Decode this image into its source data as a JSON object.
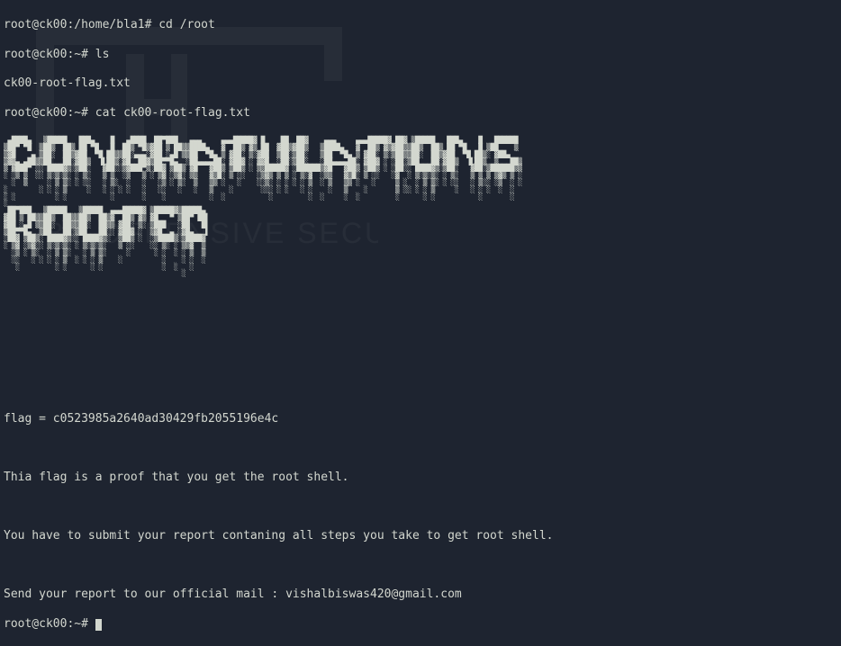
{
  "prompts": {
    "p0_userhost": "root@ck00",
    "p0_path": "/home/bla1",
    "p0_cmd": "cd /root",
    "p1_userhost": "root@ck00",
    "p1_path": "~",
    "p1_cmd": "ls",
    "ls_out": "ck00-root-flag.txt",
    "p2_userhost": "root@ck00",
    "p2_path": "~",
    "p2_cmd": "cat ck00-root-flag.txt",
    "p3_userhost": "root@ck00",
    "p3_path": "~",
    "p3_cmd": ""
  },
  "ascii_art": " ▄████▄   ▒█████   ███▄    █   ▄████  ██▀███   ▄▄▄     ▄▄▄█████▓ █    ██  ██▓    ▄▄▄     ▄▄▄█████▓ ██▓ ▒█████   ███▄    █   ██████ \n▒██▀ ▀█  ▒██▒  ██▒ ██ ▀█   █  ██▒ ▀█▒▓██ ▒ ██▒▒████▄   ▓  ██▒ ▓▒ ██  ▓██▒▓██▒   ▒████▄   ▓  ██▒ ▓▒▓██▒▒██▒  ██▒ ██ ▀█   █ ▒██    ▒ \n▒▓█    ▄ ▒██░  ██▒▓██  ▀█ ██▒▒██░▄▄▄░▓██ ░▄█ ▒▒██  ▀█▄ ▒ ▓██░ ▒░▓██  ▒██░▒██░   ▒██  ▀█▄ ▒ ▓██░ ▒░▒██▒▒██░  ██▒▓██  ▀█ ██▒░ ▓██▄   \n▒▓▓▄ ▄██▒▒██   ██░▓██▒  ▐▌██▒░▓█  ██▓▒██▀▀█▄  ░██▄▄▄▄██░ ▓██▓ ░ ▓▓█  ░██░▒██░   ░██▄▄▄▄██░ ▓██▓ ░ ░██░▒██   ██░▓██▒  ▐▌██▒  ▒   ██▒\n▒ ▓███▀ ░░ ████▓▒░▒██░   ▓██░░▒▓███▀▒░██▓ ▒██▒ ▓█   ▓██▒ ▒██▒ ░ ▒▒█████▓ ░██████▒▓█   ▓██▒ ▒██▒ ░ ░██░░ ████▓▒░▒██░   ▓██░▒██████▒▒\n░ ░▒ ▒  ░░ ▒░▒░▒░ ░ ▒░   ▒ ▒  ░▒   ▒ ░ ▒▓ ░▒▓░ ▒▒   ▓▒█░ ▒ ░░   ░▒▓▒ ▒ ▒ ░ ▒░▓  ░▒▒   ▓▒█░ ▒ ░░   ░▓  ░ ▒░▒░▒░ ░ ▒░   ▒ ▒ ▒ ▒▓▒ ▒ ░\n  ░  ▒     ░ ▒ ▒░ ░ ░░   ░ ▒░  ░   ░   ░▒ ░ ▒░  ▒   ▒▒ ░   ░    ░░▒░ ░ ░ ░ ░ ▒  ░ ▒   ▒▒ ░   ░     ▒ ░  ░ ▒ ▒░ ░ ░░   ░ ▒░░ ░▒  ░ ░\n░        ░ ░ ░ ▒     ░   ░ ░ ░ ░   ░   ░░   ░   ░   ▒    ░       ░░░ ░ ░   ░ ░    ░   ▒    ░       ▒ ░░ ░ ░ ▒     ░   ░ ░ ░  ░  ░  \n░ ░          ░ ░           ░       ░    ░           ░  ░           ░         ░  ░     ░  ░         ░      ░ ░           ░       ░  \n░                                                                                                                                  \n ██▀███   ▒█████   ▒█████  ▄▄▄█████▓ ▒█████▓▒█████▄                                                                                \n▓██ ▒ ██▒▒██▒  ██▒▒██▒  ██▒▓  ██▒ ▓▒ ▓█   ▀ ▒██▀ ██▌                                                                               \n▓██ ░▄█ ▒▒██░  ██▒▒██░  ██▒▒ ▓██░ ▒░ ▒███   ░██   █▌                                                                               \n▒██▀▀█▄  ▒██   ██░▒██   ██░░ ▓██▓ ░  ▒▓█  ▄ ░▓█▄   ▌                                                                               \n░██▓ ▒██▒░ ████▓▒░░ ████▓▒░  ▒██▒ ░  ░▒████▒░▒████▓                                                                                \n░ ▒▓ ░▒▓░░ ▒░▒░▒░ ░ ▒░▒░▒░   ▒ ░░    ░░ ▒░ ░ ▒▒▓  ▒                                                                                \n  ░▒ ░ ▒░  ░ ▒ ▒░   ░ ▒ ▒░     ░      ░ ░  ░ ░ ▒  ▒                                                                                \n  ░░   ░ ░ ░ ░ ▒  ░ ░ ░ ▒    ░          ░    ░ ░  ░                                                                                \n   ░         ░ ░      ░ ░               ░  ░   ░                                                                                   \n                                             ░                                                                                     ",
  "flag_line": "flag = c0523985a2640ad30429fb2055196e4c",
  "msg1": "Thia flag is a proof that you get the root shell.",
  "msg2": "You have to submit your report contaning all steps you take to get root shell.",
  "msg3": "Send your report to our official mail : vishalbiswas420@gmail.com"
}
